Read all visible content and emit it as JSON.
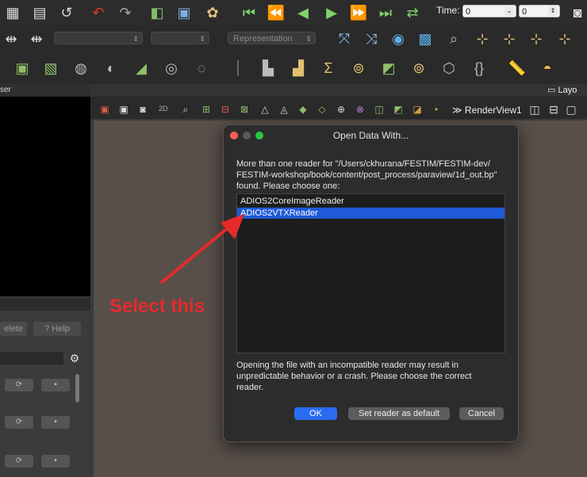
{
  "toolbar1": {
    "time_label": "Time:",
    "time_value": "0",
    "time_index": "0"
  },
  "toolbar2": {
    "representation": "Representation"
  },
  "left_panel": {
    "header": "ser",
    "delete_label": "elete",
    "help_label": "? Help"
  },
  "renderview": {
    "label": "≫ RenderView1",
    "layout_tab": "Layo",
    "mode_2d": "2D"
  },
  "dialog": {
    "title": "Open Data With...",
    "message_line1": "More than one reader for \"/Users/ckhurana/FESTIM/FESTIM-dev/",
    "message_line2": "FESTIM-workshop/book/content/post_process/paraview/1d_out.bp\"",
    "message_line3": "found. Please choose one:",
    "readers": [
      {
        "label": "ADIOS2CoreImageReader",
        "selected": false
      },
      {
        "label": "ADIOS2VTXReader",
        "selected": true
      }
    ],
    "warning_line1": "Opening the file with an incompatible reader may result in",
    "warning_line2": "unpredictable behavior or a crash.  Please choose the correct",
    "warning_line3": "reader.",
    "ok_label": "OK",
    "default_label": "Set reader as default",
    "cancel_label": "Cancel"
  },
  "annotation": {
    "text": "Select this",
    "color": "#e62a2a"
  },
  "colors": {
    "accent_selected": "#1f5ad6",
    "ok_button": "#2a6cf0",
    "canvas": "#584f49"
  }
}
